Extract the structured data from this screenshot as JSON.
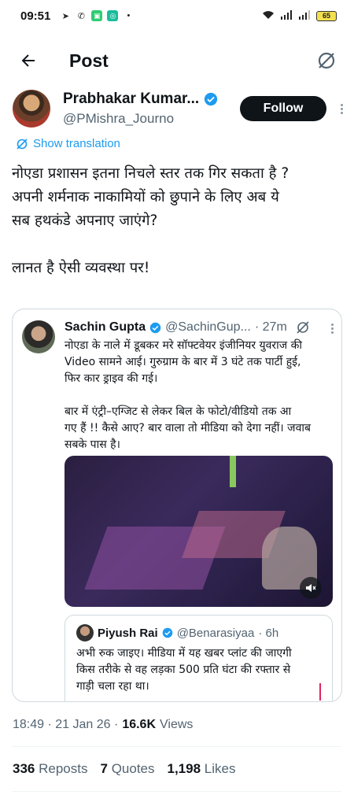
{
  "status_bar": {
    "time": "09:51",
    "battery": "65",
    "colors": {
      "green_app": "#2ecc71",
      "teal_app": "#1abc9c"
    }
  },
  "header": {
    "title": "Post"
  },
  "author": {
    "name": "Prabhakar Kumar...",
    "handle": "@PMishra_Journo",
    "follow_label": "Follow"
  },
  "translation_label": "Show translation",
  "tweet": {
    "text": "नोएडा प्रशासन इतना निचले स्तर तक गिर सकता है ?\nअपनी शर्मनाक नाकामियों को छुपाने के लिए अब ये\nसब हथकंडे अपनाए जाएंगे?\n\nलानत है ऐसी व्यवस्था पर!"
  },
  "quote": {
    "name": "Sachin Gupta",
    "handle": "@SachinGup...",
    "time": "· 27m",
    "text": "नोएडा के नाले में डूबकर मरे सॉफ्टवेयर इंजीनियर युवराज की\nVideo सामने आई। गुरुग्राम के बार में 3 घंटे तक पार्टी हुई,\nफिर कार ड्राइव की गई।\n\nबार में एंट्री–एग्जिट से लेकर बिल के फोटो/वीडियो तक आ\nगए हैं !! कैसे आए? बार वाला तो मीडिया को देगा नहीं। जवाब\nसबके पास है।",
    "nested": {
      "name": "Piyush Rai",
      "handle": "@Benarasiyaa",
      "time": "· 6h",
      "text": "अभी रुक जाइए। मीडिया में यह खबर प्लांट की जाएगी\nकिस तरीके से वह लड़का 500 प्रति घंटा की रफ्तार से\nगाड़ी चला रहा था।"
    }
  },
  "timestamp": {
    "text": "18:49 · 21 Jan 26 ·",
    "views_count": "16.6K",
    "views_label": "Views"
  },
  "stats": {
    "reposts_count": "336",
    "reposts_label": "Reposts",
    "quotes_count": "7",
    "quotes_label": "Quotes",
    "likes_count": "1,198",
    "likes_label": "Likes"
  },
  "theme": {
    "accent": "#1d9bf0",
    "text": "#0f1419",
    "muted": "#536471"
  }
}
